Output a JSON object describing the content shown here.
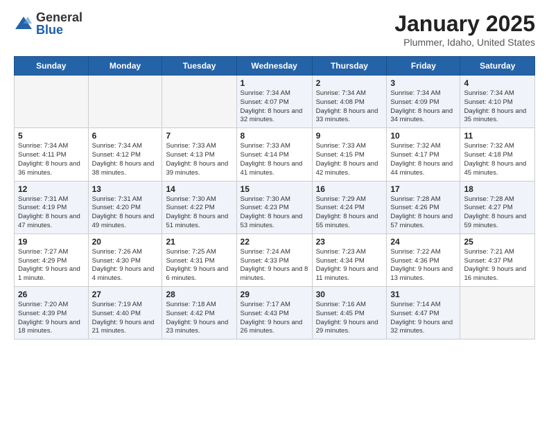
{
  "logo": {
    "general": "General",
    "blue": "Blue"
  },
  "header": {
    "month": "January 2025",
    "location": "Plummer, Idaho, United States"
  },
  "weekdays": [
    "Sunday",
    "Monday",
    "Tuesday",
    "Wednesday",
    "Thursday",
    "Friday",
    "Saturday"
  ],
  "weeks": [
    [
      {
        "day": "",
        "text": ""
      },
      {
        "day": "",
        "text": ""
      },
      {
        "day": "",
        "text": ""
      },
      {
        "day": "1",
        "text": "Sunrise: 7:34 AM\nSunset: 4:07 PM\nDaylight: 8 hours and 32 minutes."
      },
      {
        "day": "2",
        "text": "Sunrise: 7:34 AM\nSunset: 4:08 PM\nDaylight: 8 hours and 33 minutes."
      },
      {
        "day": "3",
        "text": "Sunrise: 7:34 AM\nSunset: 4:09 PM\nDaylight: 8 hours and 34 minutes."
      },
      {
        "day": "4",
        "text": "Sunrise: 7:34 AM\nSunset: 4:10 PM\nDaylight: 8 hours and 35 minutes."
      }
    ],
    [
      {
        "day": "5",
        "text": "Sunrise: 7:34 AM\nSunset: 4:11 PM\nDaylight: 8 hours and 36 minutes."
      },
      {
        "day": "6",
        "text": "Sunrise: 7:34 AM\nSunset: 4:12 PM\nDaylight: 8 hours and 38 minutes."
      },
      {
        "day": "7",
        "text": "Sunrise: 7:33 AM\nSunset: 4:13 PM\nDaylight: 8 hours and 39 minutes."
      },
      {
        "day": "8",
        "text": "Sunrise: 7:33 AM\nSunset: 4:14 PM\nDaylight: 8 hours and 41 minutes."
      },
      {
        "day": "9",
        "text": "Sunrise: 7:33 AM\nSunset: 4:15 PM\nDaylight: 8 hours and 42 minutes."
      },
      {
        "day": "10",
        "text": "Sunrise: 7:32 AM\nSunset: 4:17 PM\nDaylight: 8 hours and 44 minutes."
      },
      {
        "day": "11",
        "text": "Sunrise: 7:32 AM\nSunset: 4:18 PM\nDaylight: 8 hours and 45 minutes."
      }
    ],
    [
      {
        "day": "12",
        "text": "Sunrise: 7:31 AM\nSunset: 4:19 PM\nDaylight: 8 hours and 47 minutes."
      },
      {
        "day": "13",
        "text": "Sunrise: 7:31 AM\nSunset: 4:20 PM\nDaylight: 8 hours and 49 minutes."
      },
      {
        "day": "14",
        "text": "Sunrise: 7:30 AM\nSunset: 4:22 PM\nDaylight: 8 hours and 51 minutes."
      },
      {
        "day": "15",
        "text": "Sunrise: 7:30 AM\nSunset: 4:23 PM\nDaylight: 8 hours and 53 minutes."
      },
      {
        "day": "16",
        "text": "Sunrise: 7:29 AM\nSunset: 4:24 PM\nDaylight: 8 hours and 55 minutes."
      },
      {
        "day": "17",
        "text": "Sunrise: 7:28 AM\nSunset: 4:26 PM\nDaylight: 8 hours and 57 minutes."
      },
      {
        "day": "18",
        "text": "Sunrise: 7:28 AM\nSunset: 4:27 PM\nDaylight: 8 hours and 59 minutes."
      }
    ],
    [
      {
        "day": "19",
        "text": "Sunrise: 7:27 AM\nSunset: 4:29 PM\nDaylight: 9 hours and 1 minute."
      },
      {
        "day": "20",
        "text": "Sunrise: 7:26 AM\nSunset: 4:30 PM\nDaylight: 9 hours and 4 minutes."
      },
      {
        "day": "21",
        "text": "Sunrise: 7:25 AM\nSunset: 4:31 PM\nDaylight: 9 hours and 6 minutes."
      },
      {
        "day": "22",
        "text": "Sunrise: 7:24 AM\nSunset: 4:33 PM\nDaylight: 9 hours and 8 minutes."
      },
      {
        "day": "23",
        "text": "Sunrise: 7:23 AM\nSunset: 4:34 PM\nDaylight: 9 hours and 11 minutes."
      },
      {
        "day": "24",
        "text": "Sunrise: 7:22 AM\nSunset: 4:36 PM\nDaylight: 9 hours and 13 minutes."
      },
      {
        "day": "25",
        "text": "Sunrise: 7:21 AM\nSunset: 4:37 PM\nDaylight: 9 hours and 16 minutes."
      }
    ],
    [
      {
        "day": "26",
        "text": "Sunrise: 7:20 AM\nSunset: 4:39 PM\nDaylight: 9 hours and 18 minutes."
      },
      {
        "day": "27",
        "text": "Sunrise: 7:19 AM\nSunset: 4:40 PM\nDaylight: 9 hours and 21 minutes."
      },
      {
        "day": "28",
        "text": "Sunrise: 7:18 AM\nSunset: 4:42 PM\nDaylight: 9 hours and 23 minutes."
      },
      {
        "day": "29",
        "text": "Sunrise: 7:17 AM\nSunset: 4:43 PM\nDaylight: 9 hours and 26 minutes."
      },
      {
        "day": "30",
        "text": "Sunrise: 7:16 AM\nSunset: 4:45 PM\nDaylight: 9 hours and 29 minutes."
      },
      {
        "day": "31",
        "text": "Sunrise: 7:14 AM\nSunset: 4:47 PM\nDaylight: 9 hours and 32 minutes."
      },
      {
        "day": "",
        "text": ""
      }
    ]
  ]
}
